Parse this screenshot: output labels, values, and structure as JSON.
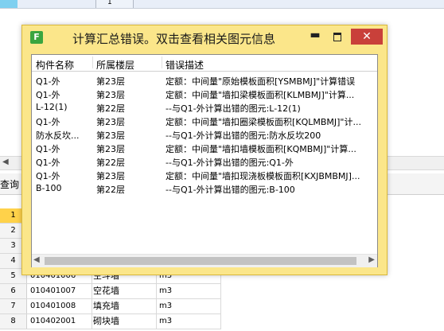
{
  "background": {
    "top_cell": "1",
    "scroll_left_arrow": "◀",
    "toolbar_label": "查询",
    "rows": [
      {
        "num": "1",
        "code": "",
        "name": "",
        "unit": ""
      },
      {
        "num": "2",
        "code": "",
        "name": "",
        "unit": ""
      },
      {
        "num": "3",
        "code": "",
        "name": "",
        "unit": ""
      },
      {
        "num": "4",
        "code": "",
        "name": "",
        "unit": ""
      },
      {
        "num": "5",
        "code": "010401006",
        "name": "空斗墙",
        "unit": "m3"
      },
      {
        "num": "6",
        "code": "010401007",
        "name": "空花墙",
        "unit": "m3"
      },
      {
        "num": "7",
        "code": "010401008",
        "name": "填充墙",
        "unit": "m3"
      },
      {
        "num": "8",
        "code": "010402001",
        "name": "砌块墙",
        "unit": "m3"
      }
    ]
  },
  "dialog": {
    "title": "计算汇总错误。双击查看相关图元信息",
    "app_icon": "F",
    "minimize": "▬",
    "close": "✕",
    "columns": [
      "构件名称",
      "所属楼层",
      "错误描述"
    ],
    "rows": [
      {
        "name": "Q1-外",
        "floor": "第23层",
        "desc": "定额：中间量\"原始模板面积[YSMBMJ]\"计算错误"
      },
      {
        "name": "Q1-外",
        "floor": "第23层",
        "desc": "定额：中间量\"墙扣梁模板面积[KLMBMJ]\"计算..."
      },
      {
        "name": "L-12(1)",
        "floor": "第22层",
        "desc": "--与Q1-外计算出错的图元:L-12(1)"
      },
      {
        "name": "Q1-外",
        "floor": "第23层",
        "desc": "定额：中间量\"墙扣圈梁模板面积[KQLMBMJ]\"计..."
      },
      {
        "name": "防水反坎...",
        "floor": "第23层",
        "desc": "--与Q1-外计算出错的图元:防水反坎200"
      },
      {
        "name": "Q1-外",
        "floor": "第23层",
        "desc": "定额：中间量\"墙扣墙模板面积[KQMBMJ]\"计算..."
      },
      {
        "name": "Q1-外",
        "floor": "第22层",
        "desc": "--与Q1-外计算出错的图元:Q1-外"
      },
      {
        "name": "Q1-外",
        "floor": "第23层",
        "desc": "定额：中间量\"墙扣现浇板模板面积[KXJBMBMJ]..."
      },
      {
        "name": "B-100",
        "floor": "第22层",
        "desc": "--与Q1-外计算出错的图元:B-100"
      }
    ],
    "scroll_left": "◀",
    "scroll_right": "▶"
  },
  "colors": {
    "dialog_bg": "#fbe68a",
    "close_button": "#c9403a",
    "selected_row_header": "#ffd24a"
  }
}
